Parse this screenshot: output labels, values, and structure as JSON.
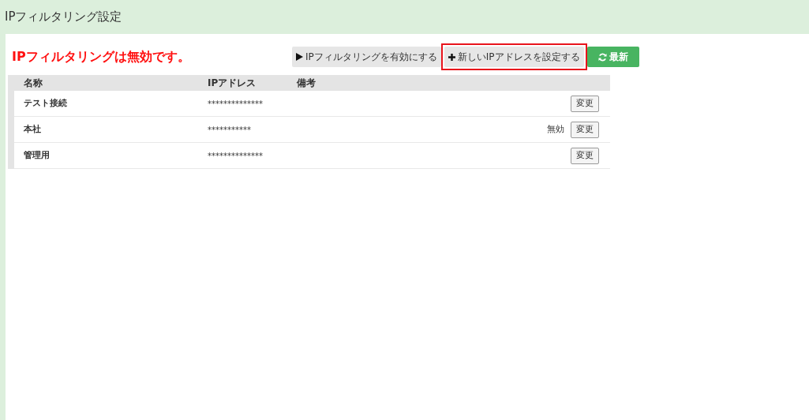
{
  "page_title": "IPフィルタリング設定",
  "status_message": "IPフィルタリングは無効です。",
  "toolbar": [
    {
      "kind": "play",
      "label": "IPフィルタリングを有効にする",
      "highlighted": false
    },
    {
      "kind": "add",
      "label": "新しいIPアドレスを設定する",
      "highlighted": true
    },
    {
      "kind": "refresh",
      "label": "最新",
      "highlighted": false
    }
  ],
  "table": {
    "columns": [
      "名称",
      "IPアドレス",
      "備考"
    ],
    "rows": [
      {
        "name": "テスト接続",
        "ip": "**************",
        "note": "",
        "action": "変更"
      },
      {
        "name": "本社",
        "ip": "***********",
        "note": "無効",
        "action": "変更"
      },
      {
        "name": "管理用",
        "ip": "**************",
        "note": "",
        "action": "変更"
      }
    ]
  }
}
